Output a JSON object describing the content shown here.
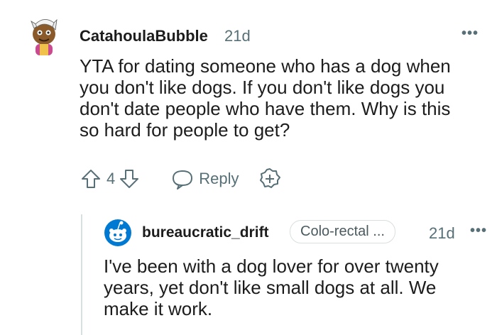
{
  "comment": {
    "username": "CatahoulaBubble",
    "age": "21d",
    "more": "•••",
    "body_lines": [
      "YTA for dating someone who has a dog when",
      "you don't like dogs. If you don't like dogs you",
      "don't date people who have them. Why is this",
      "so hard for people to get?"
    ],
    "vote_count": "4",
    "reply_label": "Reply"
  },
  "reply": {
    "username": "bureaucratic_drift",
    "flair": "Colo-rectal ...",
    "age": "21d",
    "more": "•••",
    "body_lines": [
      "I've been with a dog lover for over twenty",
      "years, yet don't like small dogs at all. We",
      "make it work."
    ]
  },
  "colors": {
    "text": "#1c1c1c",
    "meta": "#576f76",
    "snoo_blue": "#0079d3",
    "thread_line": "#d9dee0"
  }
}
